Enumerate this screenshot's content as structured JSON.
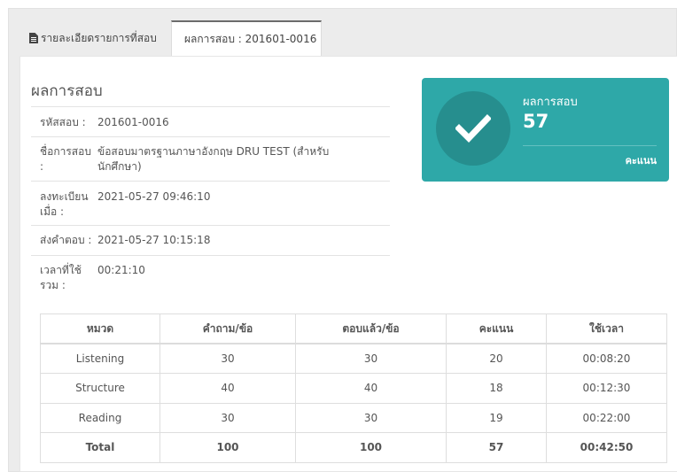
{
  "tabs": {
    "details_label": "รายละเอียดรายการที่สอบ",
    "result_label": "ผลการสอบ : 201601-0016"
  },
  "section_title": "ผลการสอบ",
  "info": {
    "exam_code_label": "รหัสสอบ :",
    "exam_code_value": "201601-0016",
    "exam_name_label": "ชื่อการสอบ :",
    "exam_name_value": "ข้อสอบมาตรฐานภาษาอังกฤษ DRU TEST (สำหรับนักศึกษา)",
    "registered_label": "ลงทะเบียนเมื่อ :",
    "registered_value": "2021-05-27 09:46:10",
    "submitted_label": "ส่งคำตอบ :",
    "submitted_value": "2021-05-27 10:15:18",
    "time_used_label": "เวลาที่ใช้รวม :",
    "time_used_value": "00:21:10"
  },
  "score_card": {
    "label": "ผลการสอบ",
    "value": "57",
    "unit": "คะแนน",
    "icon": "check-icon",
    "color": "#2ea8a8"
  },
  "table": {
    "headers": [
      "หมวด",
      "คำถาม/ข้อ",
      "ตอบแล้ว/ข้อ",
      "คะแนน",
      "ใช้เวลา"
    ],
    "rows": [
      [
        "Listening",
        "30",
        "30",
        "20",
        "00:08:20"
      ],
      [
        "Structure",
        "40",
        "40",
        "18",
        "00:12:30"
      ],
      [
        "Reading",
        "30",
        "30",
        "19",
        "00:22:00"
      ]
    ],
    "total": [
      "Total",
      "100",
      "100",
      "57",
      "00:42:50"
    ]
  }
}
